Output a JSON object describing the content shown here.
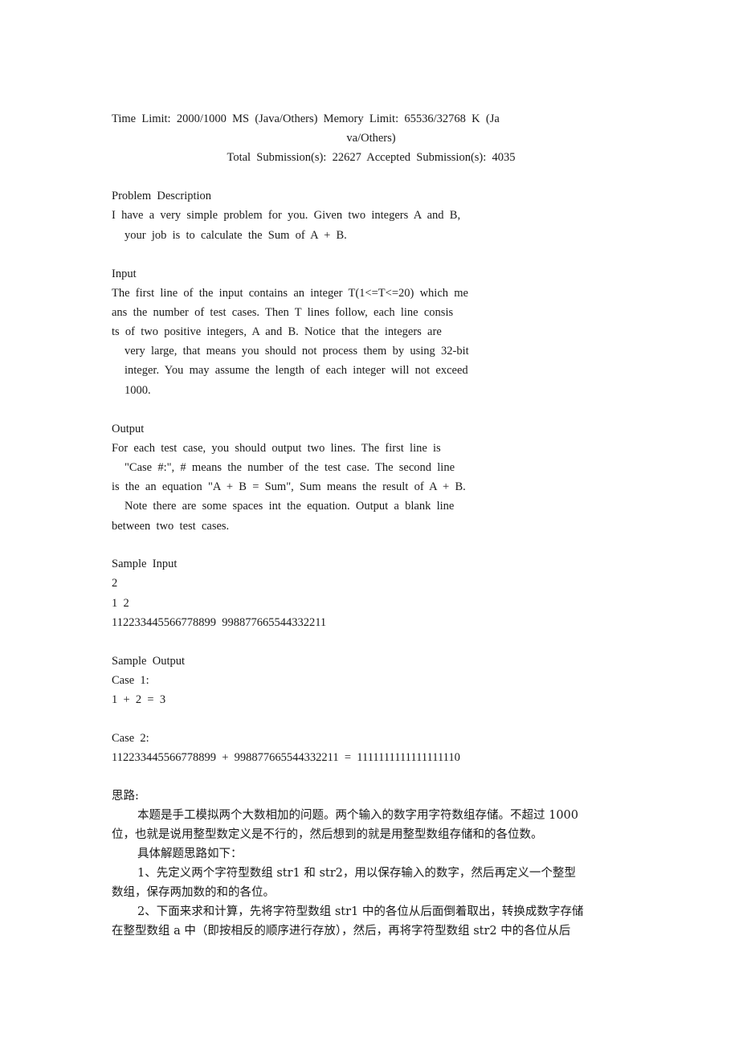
{
  "header": {
    "limits_line1": "Time  Limit:  2000/1000  MS  (Java/Others)  Memory  Limit:  65536/32768  K  (Ja",
    "limits_line2": "va/Others)",
    "submissions": "Total  Submission(s):  22627  Accepted  Submission(s):  4035"
  },
  "problem": {
    "heading": "Problem  Description",
    "lines": [
      "I  have  a  very  simple  problem  for  you.  Given  two  integers  A  and  B,",
      "your  job  is  to  calculate  the  Sum  of  A  +  B."
    ]
  },
  "input": {
    "heading": "Input",
    "lines": [
      "The  first  line  of  the  input  contains  an  integer  T(1<=T<=20)  which  me",
      "ans  the  number  of  test  cases.  Then  T  lines  follow,  each  line  consis",
      "ts  of  two  positive  integers,  A  and  B.  Notice  that  the  integers  are",
      "very  large,  that  means  you  should  not  process  them  by  using  32-bit",
      "integer.  You  may  assume  the  length  of  each  integer  will  not  exceed",
      "1000."
    ]
  },
  "output": {
    "heading": "Output",
    "lines": [
      "For  each  test  case,  you  should  output  two  lines.  The  first  line  is",
      "\"Case  #:\",  #  means  the  number  of  the  test  case.  The  second  line",
      "is  the  an  equation  \"A  +  B  =  Sum\",  Sum  means  the  result  of  A  +  B.",
      "Note  there  are  some  spaces  int  the  equation.  Output  a  blank  line",
      "between  two  test  cases."
    ]
  },
  "sample_input": {
    "heading": "Sample  Input",
    "lines": [
      "2",
      "1  2",
      "112233445566778899  998877665544332211"
    ]
  },
  "sample_output": {
    "heading": "Sample  Output",
    "lines": [
      "Case  1:",
      "1  +  2  =  3",
      "Case  2:",
      "112233445566778899  +  998877665544332211  =  1111111111111111110"
    ]
  },
  "solution": {
    "heading": "思路:",
    "lines": [
      "本题是手工模拟两个大数相加的问题。两个输入的数字用字符数组存储。不超过 1000",
      "位，也就是说用整型数定义是不行的，然后想到的就是用整型数组存储和的各位数。",
      "具体解题思路如下：",
      "1、先定义两个字符型数组 str1 和 str2，用以保存输入的数字，然后再定义一个整型",
      "数组，保存两加数的和的各位。",
      "2、下面来求和计算，先将字符型数组 str1 中的各位从后面倒着取出，转换成数字存储",
      "在整型数组 a 中（即按相反的顺序进行存放），然后，再将字符型数组 str2 中的各位从后"
    ]
  }
}
